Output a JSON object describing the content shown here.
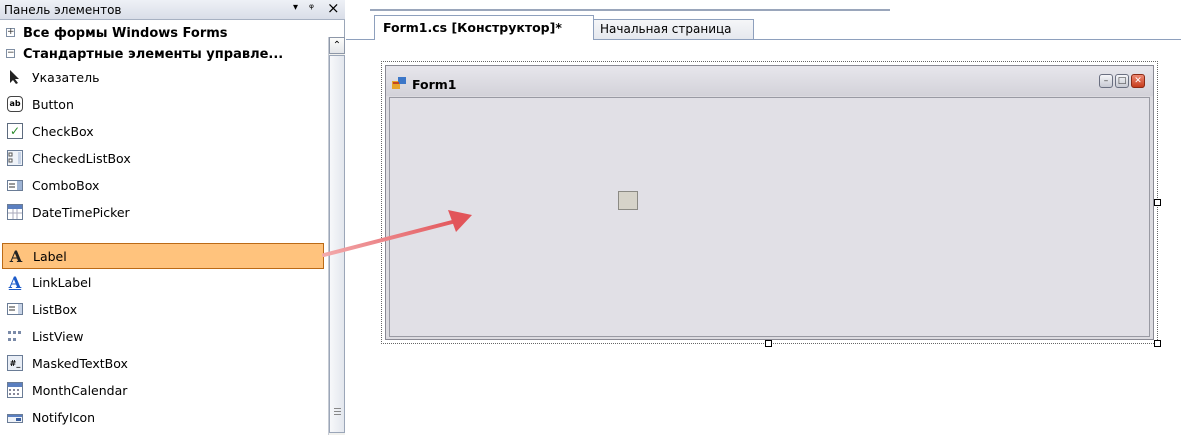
{
  "toolbox": {
    "title": "Панель элементов",
    "dropdown_glyph": "▾",
    "pin_glyph": "ᵠ",
    "close_glyph": "×",
    "categories": [
      {
        "label": "Все формы Windows Forms",
        "expander": "+"
      },
      {
        "label": "Стандартные элементы управле...",
        "expander": "−"
      }
    ],
    "items": [
      {
        "label": "Указатель",
        "icon": "pointer-icon"
      },
      {
        "label": "Button",
        "icon": "button-icon",
        "glyph": "ab"
      },
      {
        "label": "CheckBox",
        "icon": "checkbox-icon",
        "glyph": "✓"
      },
      {
        "label": "CheckedListBox",
        "icon": "checkedlistbox-icon"
      },
      {
        "label": "ComboBox",
        "icon": "combobox-icon"
      },
      {
        "label": "DateTimePicker",
        "icon": "datetimepicker-icon"
      },
      {
        "label": "Label",
        "icon": "label-icon",
        "glyph": "A",
        "selected": true
      },
      {
        "label": "LinkLabel",
        "icon": "linklabel-icon",
        "glyph": "A"
      },
      {
        "label": "ListBox",
        "icon": "listbox-icon"
      },
      {
        "label": "ListView",
        "icon": "listview-icon"
      },
      {
        "label": "MaskedTextBox",
        "icon": "maskedtextbox-icon",
        "glyph": "#_"
      },
      {
        "label": "MonthCalendar",
        "icon": "monthcalendar-icon"
      },
      {
        "label": "NotifyIcon",
        "icon": "notifyicon-icon"
      }
    ],
    "scroll_up_glyph": "⌃"
  },
  "designer": {
    "tabs": [
      {
        "label": "Form1.cs [Конструктор]*",
        "active": true
      },
      {
        "label": "Начальная страница",
        "active": false
      }
    ],
    "form": {
      "title": "Form1",
      "minimize_glyph": "–",
      "maximize_glyph": "□",
      "close_glyph": "✕"
    }
  },
  "colors": {
    "selected_item_bg": "#ffc37d",
    "form_bg": "#dcdbe0",
    "drag_arrow": "#e2555a"
  }
}
